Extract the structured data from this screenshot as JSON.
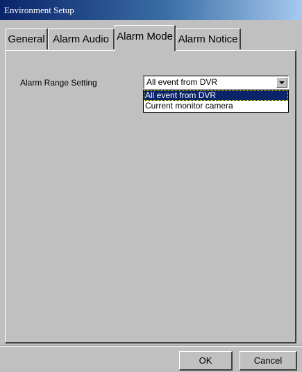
{
  "window": {
    "title": "Environment Setup"
  },
  "tabs": [
    {
      "label": "General"
    },
    {
      "label": "Alarm Audio"
    },
    {
      "label": "Alarm Mode"
    },
    {
      "label": "Alarm Notice"
    }
  ],
  "active_tab": "Alarm Mode",
  "alarm_range": {
    "label": "Alarm Range Setting",
    "selected": "All event from DVR",
    "options": [
      "All event from DVR",
      "Current monitor camera"
    ]
  },
  "buttons": {
    "ok": "OK",
    "cancel": "Cancel"
  }
}
